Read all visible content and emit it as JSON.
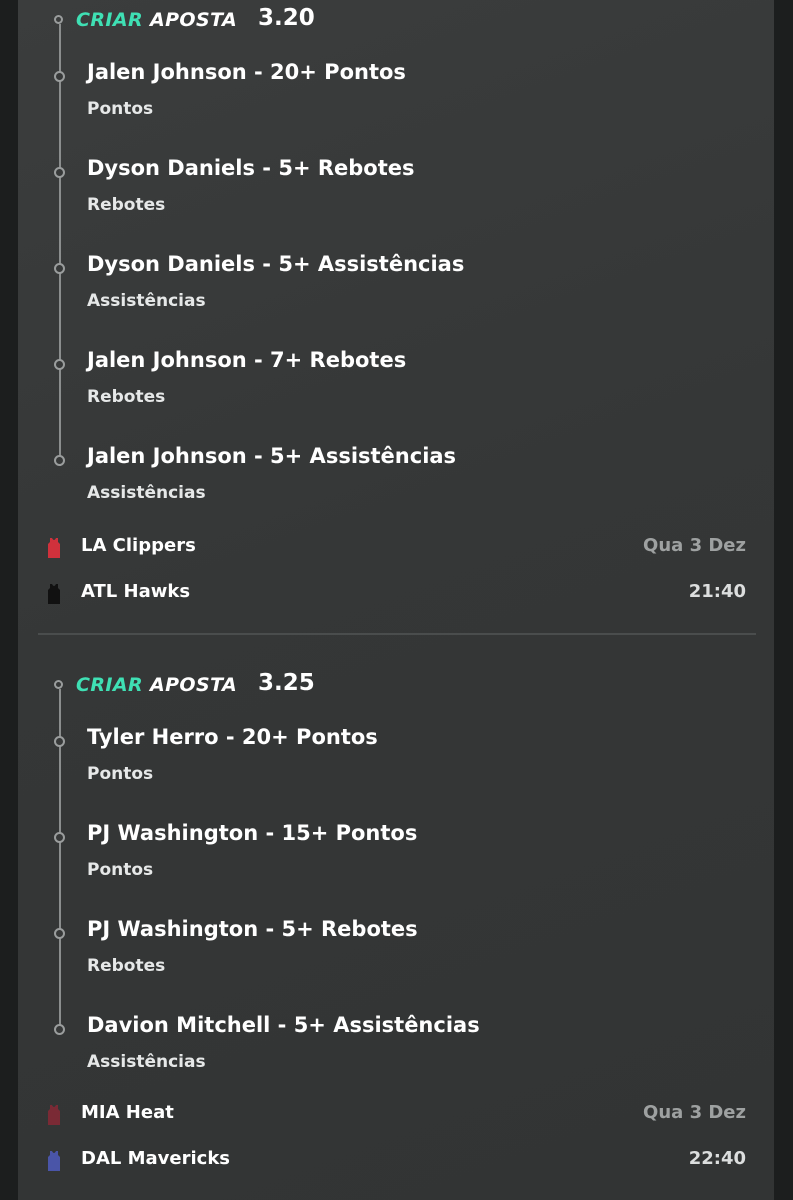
{
  "brand": {
    "part1": "CRIAR",
    "part2": "APOSTA"
  },
  "colors": {
    "brand_accent": "#3fe0b4",
    "clippers_jersey": "#d0313c",
    "hawks_jersey": "#111111",
    "heat_jersey": "#7a2a35",
    "mavericks_jersey": "#4a55a8"
  },
  "bets": [
    {
      "odds": "3.20",
      "legs": [
        {
          "title": "Jalen Johnson - 20+ Pontos",
          "market": "Pontos"
        },
        {
          "title": "Dyson Daniels - 5+ Rebotes",
          "market": "Rebotes"
        },
        {
          "title": "Dyson Daniels - 5+ Assistências",
          "market": "Assistências"
        },
        {
          "title": "Jalen Johnson - 7+ Rebotes",
          "market": "Rebotes"
        },
        {
          "title": "Jalen Johnson - 5+ Assistências",
          "market": "Assistências"
        }
      ],
      "match": {
        "home": "LA Clippers",
        "away": "ATL Hawks",
        "date": "Qua 3 Dez",
        "time": "21:40"
      }
    },
    {
      "odds": "3.25",
      "legs": [
        {
          "title": "Tyler Herro - 20+ Pontos",
          "market": "Pontos"
        },
        {
          "title": "PJ Washington - 15+ Pontos",
          "market": "Pontos"
        },
        {
          "title": "PJ Washington - 5+ Rebotes",
          "market": "Rebotes"
        },
        {
          "title": "Davion Mitchell - 5+ Assistências",
          "market": "Assistências"
        }
      ],
      "match": {
        "home": "MIA Heat",
        "away": "DAL Mavericks",
        "date": "Qua 3 Dez",
        "time": "22:40"
      }
    }
  ]
}
